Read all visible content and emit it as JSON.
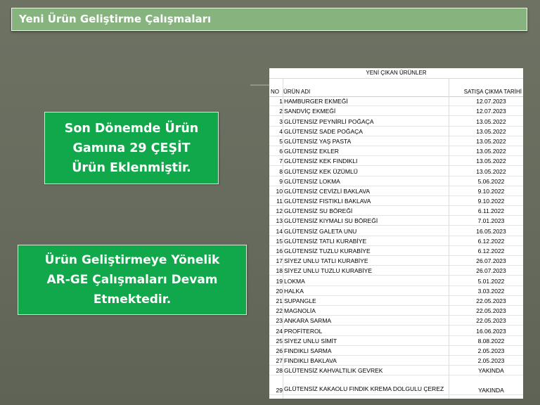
{
  "title": "Yeni Ürün Geliştirme Çalışmaları",
  "box1_lines": [
    "Son Dönemde Ürün",
    "Gamına 29 ÇEŞİT",
    "Ürün Eklenmiştir."
  ],
  "box2_lines": [
    "Ürün Geliştirmeye Yönelik",
    "AR-GE Çalışmaları Devam",
    "Etmektedir."
  ],
  "table": {
    "caption": "YENİ ÇIKAN ÜRÜNLER",
    "headers": {
      "no": "NO",
      "name": "ÜRÜN ADI",
      "date": "SATIŞA ÇIKMA TARİHİ"
    },
    "rows": [
      {
        "no": "1",
        "name": "HAMBURGER EKMEĞİ",
        "date": "12.07.2023"
      },
      {
        "no": "2",
        "name": "SANDVİÇ EKMEĞİ",
        "date": "12.07.2023"
      },
      {
        "no": "3",
        "name": "GLÜTENSİZ PEYNİRLİ POĞAÇA",
        "date": "13.05.2022"
      },
      {
        "no": "4",
        "name": "GLÜTENSİZ SADE POĞAÇA",
        "date": "13.05.2022"
      },
      {
        "no": "5",
        "name": "GLÜTENSİZ YAŞ PASTA",
        "date": "13.05.2022"
      },
      {
        "no": "6",
        "name": "GLÜTENSİZ EKLER",
        "date": "13.05.2022"
      },
      {
        "no": "7",
        "name": "GLÜTENSİZ KEK FINDIKLI",
        "date": "13.05.2022"
      },
      {
        "no": "8",
        "name": "GLÜTENSİZ KEK ÜZÜMLÜ",
        "date": "13.05.2022"
      },
      {
        "no": "9",
        "name": "GLÜTENSİZ LOKMA",
        "date": "5.06.2022"
      },
      {
        "no": "10",
        "name": "GLÜTENSİZ CEVİZLİ BAKLAVA",
        "date": "9.10.2022"
      },
      {
        "no": "11",
        "name": "GLÜTENSİZ FISTIKLI BAKLAVA",
        "date": "9.10.2022"
      },
      {
        "no": "12",
        "name": "GLÜTENSİZ SU BÖREĞİ",
        "date": "6.11.2022"
      },
      {
        "no": "13",
        "name": "GLÜTENSİZ KIYMALI SU BÖREĞİ",
        "date": "7.01.2023"
      },
      {
        "no": "14",
        "name": "GLÜTENSİZ GALETA UNU",
        "date": "16.05.2023"
      },
      {
        "no": "15",
        "name": "GLÜTENSİZ TATLI KURABİYE",
        "date": "6.12.2022"
      },
      {
        "no": "16",
        "name": "GLÜTENSİZ TUZLU KURABİYE",
        "date": "6.12.2022"
      },
      {
        "no": "17",
        "name": "SİYEZ UNLU TATLI KURABİYE",
        "date": "26.07.2023"
      },
      {
        "no": "18",
        "name": "SİYEZ UNLU TUZLU KURABİYE",
        "date": "26.07.2023"
      },
      {
        "no": "19",
        "name": "LOKMA",
        "date": "5.01.2022"
      },
      {
        "no": "20",
        "name": "HALKA",
        "date": "3.03.2022"
      },
      {
        "no": "21",
        "name": "SUPANGLE",
        "date": "22.05.2023"
      },
      {
        "no": "22",
        "name": "MAGNOLİA",
        "date": "22.05.2023"
      },
      {
        "no": "23",
        "name": "ANKARA SARMA",
        "date": "22.05.2023"
      },
      {
        "no": "24",
        "name": "PROFİTEROL",
        "date": "16.06.2023"
      },
      {
        "no": "25",
        "name": "SİYEZ UNLU SİMİT",
        "date": "8.08.2022"
      },
      {
        "no": "26",
        "name": "FINDIKLI SARMA",
        "date": "2.05.2023"
      },
      {
        "no": "27",
        "name": "FINDIKLI BAKLAVA",
        "date": "2.05.2023"
      },
      {
        "no": "28",
        "name": "GLÜTENSİZ KAHVALTILIK GEVREK",
        "date": "YAKINDA"
      },
      {
        "no": "29",
        "name": "GLÜTENSİZ KAKAOLU FINDIK KREMA DOLGULU ÇEREZ",
        "date": "YAKINDA"
      }
    ]
  },
  "colors": {
    "title_bar": "#86b37e",
    "box": "#11a84b",
    "background": "#696d5f"
  }
}
